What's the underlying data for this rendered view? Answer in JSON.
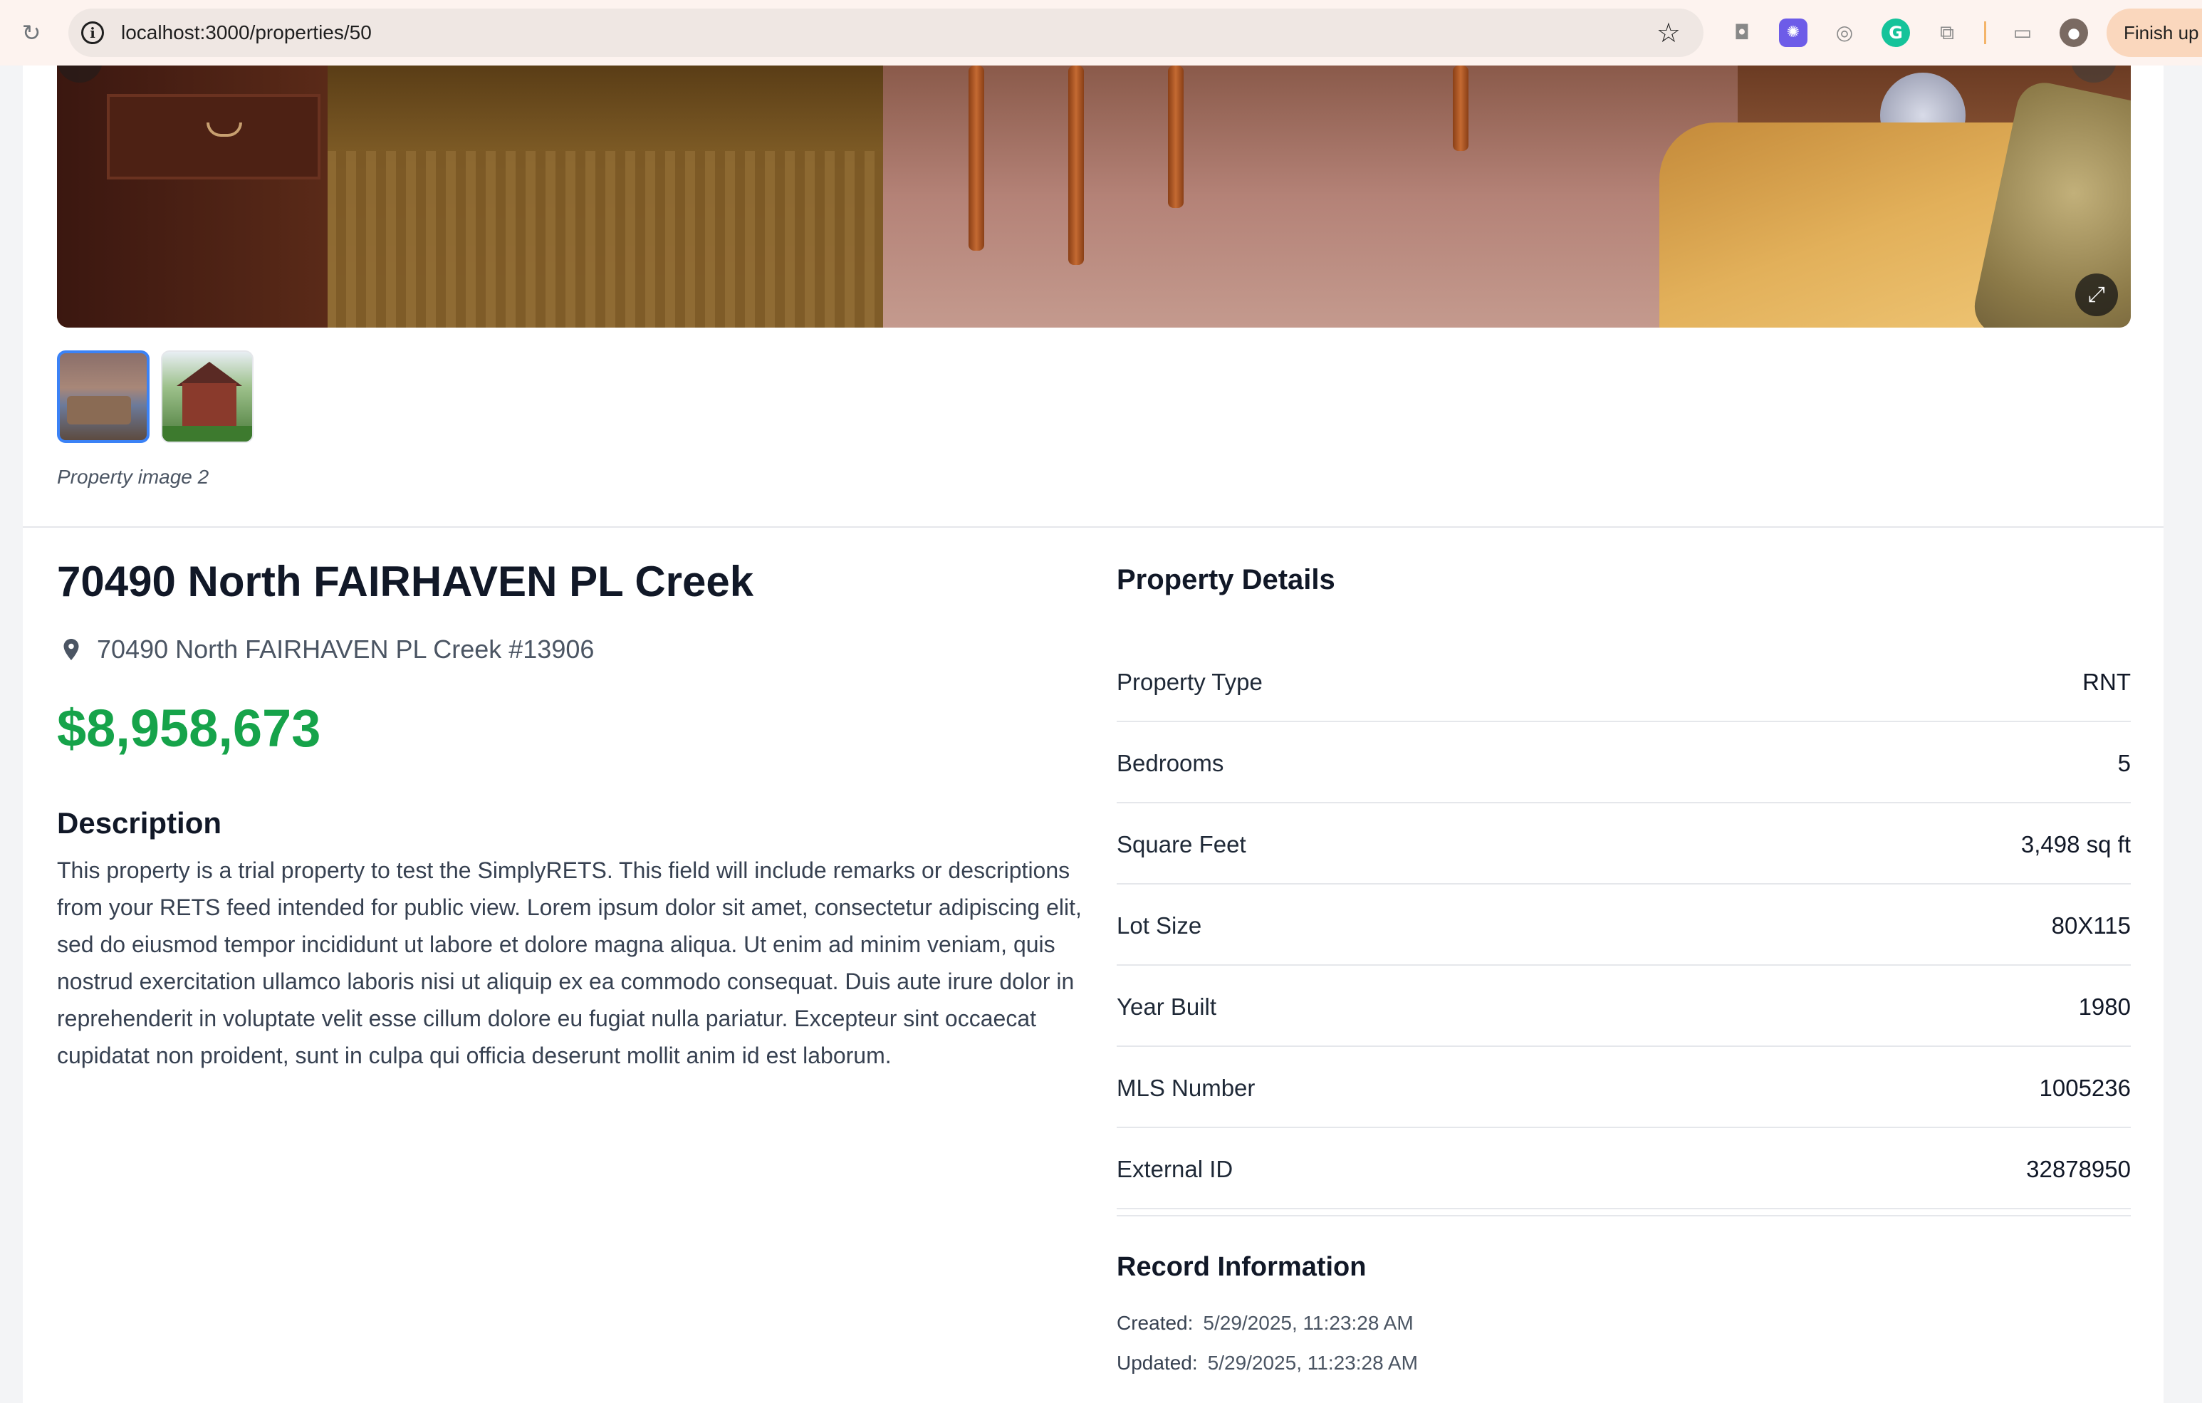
{
  "browser": {
    "url": "localhost:3000/properties/50",
    "finish_button": "Finish up"
  },
  "gallery": {
    "caption": "Property image 2",
    "thumbnails": [
      "Property image 1",
      "Property image 2"
    ]
  },
  "property": {
    "title": "70490 North FAIRHAVEN PL Creek",
    "address": "70490 North FAIRHAVEN PL Creek #13906",
    "price": "$8,958,673",
    "description_heading": "Description",
    "description": "This property is a trial property to test the SimplyRETS. This field will include remarks or descriptions from your RETS feed intended for public view. Lorem ipsum dolor sit amet, consectetur adipiscing elit, sed do eiusmod tempor incididunt ut labore et dolore magna aliqua. Ut enim ad minim veniam, quis nostrud exercitation ullamco laboris nisi ut aliquip ex ea commodo consequat. Duis aute irure dolor in reprehenderit in voluptate velit esse cillum dolore eu fugiat nulla pariatur. Excepteur sint occaecat cupidatat non proident, sunt in culpa qui officia deserunt mollit anim id est laborum."
  },
  "details": {
    "heading": "Property Details",
    "rows": [
      {
        "label": "Property Type",
        "value": "RNT"
      },
      {
        "label": "Bedrooms",
        "value": "5"
      },
      {
        "label": "Square Feet",
        "value": "3,498 sq ft"
      },
      {
        "label": "Lot Size",
        "value": "80X115"
      },
      {
        "label": "Year Built",
        "value": "1980"
      },
      {
        "label": "MLS Number",
        "value": "1005236"
      },
      {
        "label": "External ID",
        "value": "32878950"
      }
    ]
  },
  "record": {
    "heading": "Record Information",
    "created_label": "Created:",
    "created": "5/29/2025, 11:23:28 AM",
    "updated_label": "Updated:",
    "updated": "5/29/2025, 11:23:28 AM"
  },
  "colors": {
    "price": "#16a34a",
    "active_thumb_border": "#3b82f6"
  }
}
